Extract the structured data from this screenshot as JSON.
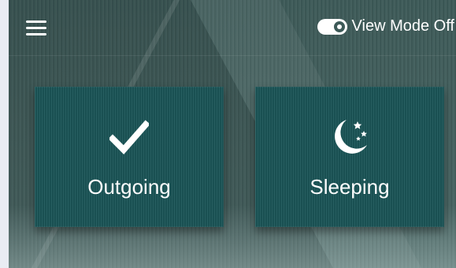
{
  "header": {
    "view_mode_label": "View Mode Off"
  },
  "cards": [
    {
      "label": "Outgoing",
      "icon": "checkmark-icon"
    },
    {
      "label": "Sleeping",
      "icon": "moon-stars-icon"
    }
  ],
  "colors": {
    "card": "#1b5557",
    "background": "#3d5a58",
    "text": "#ffffff"
  }
}
